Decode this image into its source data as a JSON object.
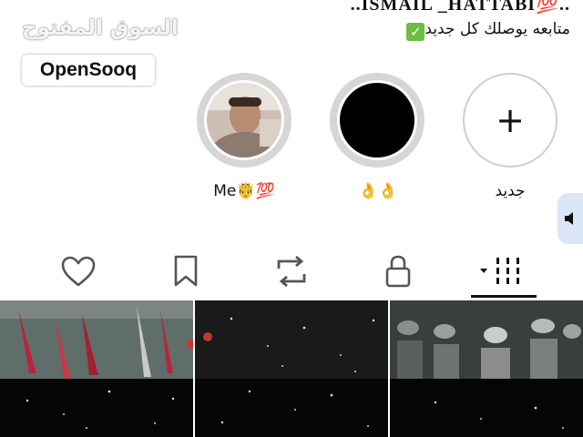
{
  "profile": {
    "name": "..ISMAIL _HATTABI💯..",
    "bio": "متابعه يوصلك كل جديد",
    "bio_check": "✓"
  },
  "watermark": {
    "arabic": "السوق المفتوح",
    "brand": "OpenSooq"
  },
  "stories": [
    {
      "label": "جديد",
      "icon": "plus-icon"
    },
    {
      "label": "👌👌",
      "icon": "black-circle"
    },
    {
      "label": "Me🤴💯",
      "icon": "avatar-photo"
    }
  ],
  "tabs": [
    {
      "name": "grid",
      "icon": "grid-icon",
      "selected": true
    },
    {
      "name": "private",
      "icon": "lock-icon",
      "selected": false
    },
    {
      "name": "reposts",
      "icon": "repost-icon",
      "selected": false
    },
    {
      "name": "saved",
      "icon": "bookmark-icon",
      "selected": false
    },
    {
      "name": "liked",
      "icon": "heart-icon",
      "selected": false
    }
  ],
  "colors": {
    "accent_tab": "#dbe6f7",
    "check_green": "#6bbd45"
  }
}
